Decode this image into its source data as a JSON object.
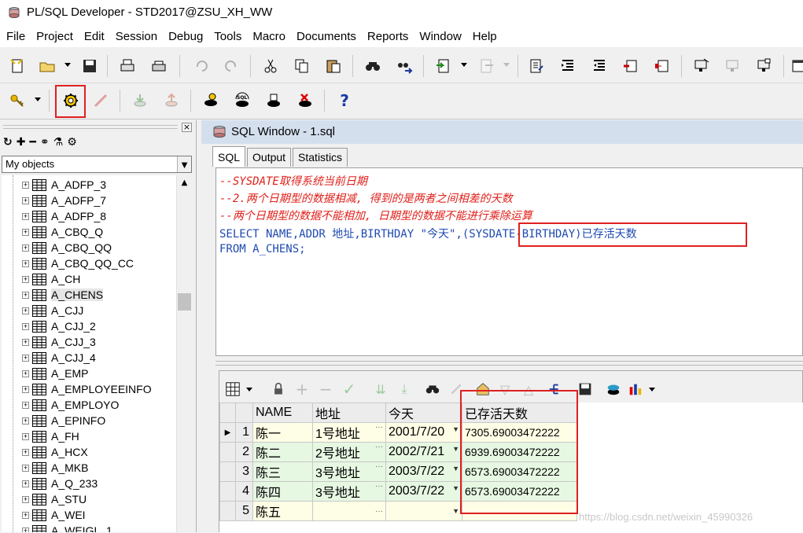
{
  "window": {
    "title": "PL/SQL Developer - STD2017@ZSU_XH_WW"
  },
  "menu": [
    "File",
    "Project",
    "Edit",
    "Session",
    "Debug",
    "Tools",
    "Macro",
    "Documents",
    "Reports",
    "Window",
    "Help"
  ],
  "left_panel": {
    "close_label": "×",
    "selector_value": "My objects",
    "tree_items": [
      "A_ADFP_3",
      "A_ADFP_7",
      "A_ADFP_8",
      "A_CBQ_Q",
      "A_CBQ_QQ",
      "A_CBQ_QQ_CC",
      "A_CH",
      "A_CHENS",
      "A_CJJ",
      "A_CJJ_2",
      "A_CJJ_3",
      "A_CJJ_4",
      "A_EMP",
      "A_EMPLOYEEINFO",
      "A_EMPLOYO",
      "A_EPINFO",
      "A_FH",
      "A_HCX",
      "A_MKB",
      "A_Q_233",
      "A_STU",
      "A_WEI",
      "A_WEIGL_1"
    ],
    "selected_item": "A_CHENS"
  },
  "sql_window": {
    "title": "SQL Window - 1.sql",
    "tabs": [
      "SQL",
      "Output",
      "Statistics"
    ],
    "active_tab": "SQL",
    "code": {
      "comment1": "--SYSDATE取得系统当前日期",
      "comment2": "--2.两个日期型的数据相减, 得到的是两者之间相差的天数",
      "comment3": "--两个日期型的数据不能相加, 日期型的数据不能进行乘除运算",
      "line4_a": "SELECT NAME,ADDR 地址,BIRTHDAY \"今天\",",
      "line4_b": "(SYSDATE-BIRTHDAY)已存活天数",
      "line5": "FROM A_CHENS;"
    }
  },
  "result_grid": {
    "columns": [
      "NAME",
      "地址",
      "今天",
      "已存活天数"
    ],
    "rows": [
      {
        "n": "1",
        "name": "陈一",
        "addr": "1号地址",
        "date": "2001/7/20",
        "days": "7305.69003472222"
      },
      {
        "n": "2",
        "name": "陈二",
        "addr": "2号地址",
        "date": "2002/7/21",
        "days": "6939.69003472222"
      },
      {
        "n": "3",
        "name": "陈三",
        "addr": "3号地址",
        "date": "2003/7/22",
        "days": "6573.69003472222"
      },
      {
        "n": "4",
        "name": "陈四",
        "addr": "3号地址",
        "date": "2003/7/22",
        "days": "6573.69003472222"
      },
      {
        "n": "5",
        "name": "陈五",
        "addr": "",
        "date": "",
        "days": ""
      }
    ],
    "ellipsis": "···"
  },
  "watermark": "https://blog.csdn.net/weixin_45990326",
  "colors": {
    "comment": "#e0201a",
    "keyword": "#1f4ab0",
    "highlight_box": "#e02020"
  }
}
